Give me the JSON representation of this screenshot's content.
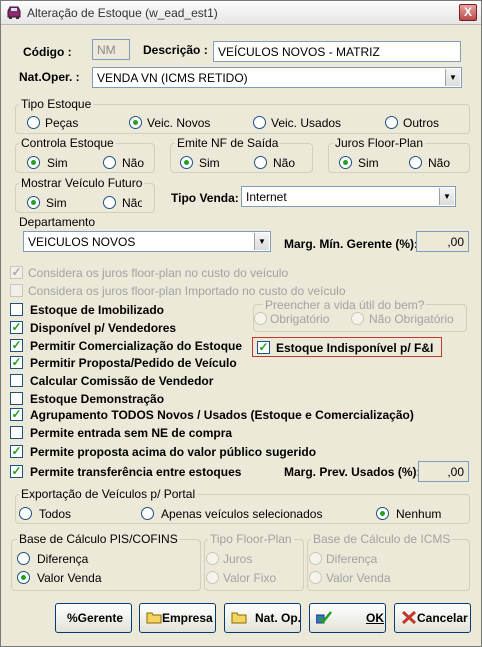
{
  "window": {
    "title": "Alteração de Estoque (w_ead_est1)",
    "close_label": "X"
  },
  "header": {
    "codigo_label": "Código :",
    "codigo_value": "NM",
    "descricao_label": "Descrição :",
    "descricao_value": "VEÍCULOS NOVOS - MATRIZ",
    "natoper_label": "Nat.Oper. :",
    "natoper_value": "VENDA VN (ICMS RETIDO)"
  },
  "tipo_estoque": {
    "title": "Tipo Estoque",
    "options": [
      "Peças",
      "Veic. Novos",
      "Veic. Usados",
      "Outros"
    ],
    "selected": "Veic. Novos"
  },
  "controla_estoque": {
    "title": "Controla Estoque",
    "sim": "Sim",
    "nao": "Não",
    "selected": "Sim"
  },
  "emite_nf": {
    "title": "Emite NF de Saída",
    "sim": "Sim",
    "nao": "Não",
    "selected": "Sim"
  },
  "juros_floor": {
    "title": "Juros Floor-Plan",
    "sim": "Sim",
    "nao": "Não",
    "selected": "Sim"
  },
  "mostrar_futuro": {
    "title": "Mostrar Veículo Futuro",
    "sim": "Sim",
    "nao": "Não",
    "selected": "Sim"
  },
  "tipo_venda": {
    "label": "Tipo Venda:",
    "value": "Internet"
  },
  "departamento": {
    "title": "Departamento",
    "value": "VEICULOS NOVOS"
  },
  "marg_min": {
    "label": "Marg. Mín. Gerente (%):",
    "value": ",00"
  },
  "disabled_checks": [
    {
      "label": "Considera os juros floor-plan no custo do veículo",
      "checked": true
    },
    {
      "label": "Considera os juros floor-plan Importado no custo do veículo",
      "checked": false
    }
  ],
  "preencher": {
    "title": "Preencher a vida útil do bem?",
    "obrigatorio": "Obrigatório",
    "nao_obrigatorio": "Não Obrigatório"
  },
  "checks_left": [
    {
      "label": "Estoque de Imobilizado",
      "checked": false
    },
    {
      "label": "Disponível p/ Vendedores",
      "checked": true
    },
    {
      "label": "Permitir Comercialização do Estoque",
      "checked": true
    },
    {
      "label": "Permitir Proposta/Pedido de Veículo",
      "checked": true
    },
    {
      "label": "Calcular Comissão de Vendedor",
      "checked": false
    },
    {
      "label": "Estoque Demonstração",
      "checked": false
    },
    {
      "label": "Agrupamento TODOS Novos / Usados (Estoque e Comercialização)",
      "checked": true
    },
    {
      "label": "Permite entrada sem NE de compra",
      "checked": false
    },
    {
      "label": "Permite proposta acima do valor público sugerido",
      "checked": true
    },
    {
      "label": "Permite transferência entre estoques",
      "checked": true
    }
  ],
  "estoque_indisponivel": {
    "label": "Estoque Indisponível p/ F&I",
    "checked": true
  },
  "marg_prev": {
    "label": "Marg. Prev. Usados (%):",
    "value": ",00"
  },
  "exportacao": {
    "title": "Exportação de Veículos p/ Portal",
    "options": [
      "Todos",
      "Apenas veículos selecionados",
      "Nenhum"
    ],
    "selected": "Nenhum"
  },
  "base_pis": {
    "title": "Base de Cálculo PIS/COFINS",
    "options": [
      "Diferença",
      "Valor Venda"
    ],
    "selected": "Valor Venda"
  },
  "tipo_floor": {
    "title": "Tipo Floor-Plan",
    "options": [
      "Juros",
      "Valor Fixo"
    ]
  },
  "base_icms": {
    "title": "Base de Cálculo de ICMS",
    "options": [
      "Diferença",
      "Valor Venda"
    ]
  },
  "buttons": {
    "gerente": "%Gerente",
    "empresa": "Empresa",
    "natop": "Nat. Op.",
    "ok": "OK",
    "cancelar": "Cancelar"
  },
  "colors": {
    "accent": "#21a121",
    "highlight_border": "#c0392b",
    "window_bg": "#ece9d8"
  }
}
